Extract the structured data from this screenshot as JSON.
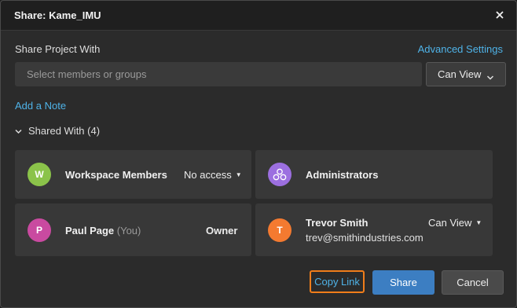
{
  "dialog": {
    "title": "Share: Kame_IMU",
    "close_icon": "close-icon"
  },
  "share": {
    "label": "Share Project With",
    "advanced_link": "Advanced Settings",
    "placeholder": "Select members or groups",
    "permission": "Can View"
  },
  "add_note": "Add a Note",
  "shared_with": {
    "label": "Shared With (4)",
    "entries": [
      {
        "avatar_letter": "W",
        "avatar_color": "#8bc34a",
        "name": "Workspace Members",
        "role": "No access"
      },
      {
        "avatar_icon": "group-icon",
        "avatar_color": "#9c6fe0",
        "name": "Administrators"
      },
      {
        "avatar_letter": "P",
        "avatar_color": "#c94aa0",
        "name": "Paul Page",
        "you_suffix": "(You)",
        "role": "Owner"
      },
      {
        "avatar_letter": "T",
        "avatar_color": "#f47a30",
        "name": "Trevor Smith",
        "email": "trev@smithindustries.com",
        "role": "Can View"
      }
    ]
  },
  "footer": {
    "copy_link": "Copy Link",
    "share": "Share",
    "cancel": "Cancel"
  },
  "colors": {
    "accent_link": "#4fb3e8",
    "primary_button": "#3c7ec2",
    "focus_outline": "#f07d1a"
  }
}
